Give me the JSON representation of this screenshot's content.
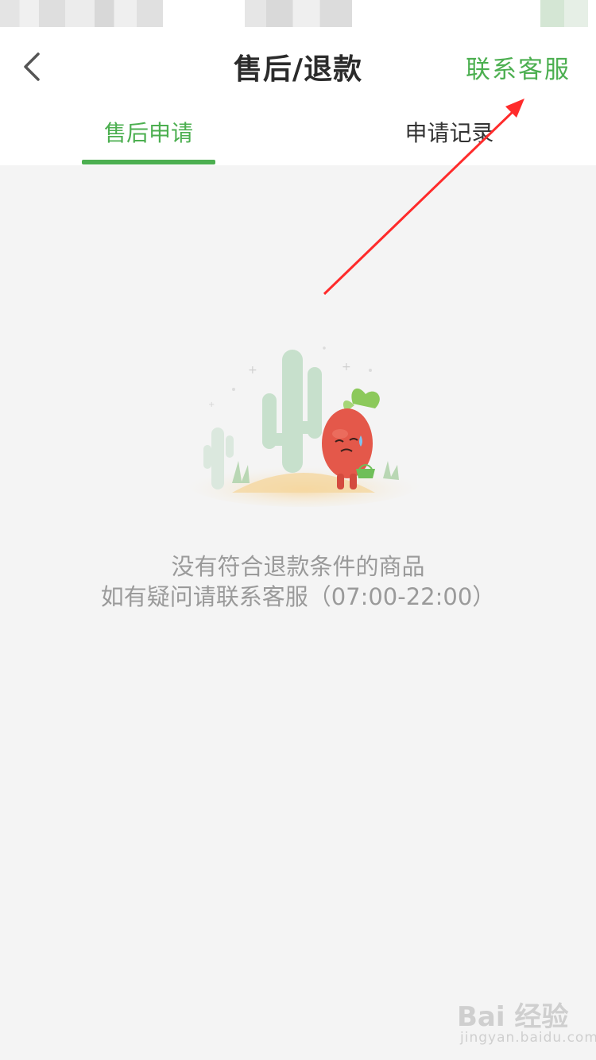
{
  "header": {
    "title": "售后/退款",
    "contact_label": "联系客服"
  },
  "tabs": [
    {
      "label": "售后申请",
      "active": true
    },
    {
      "label": "申请记录",
      "active": false
    }
  ],
  "empty_state": {
    "line1": "没有符合退款条件的商品",
    "line2": "如有疑问请联系客服（07:00-22:00）"
  },
  "watermark": {
    "brand": "Bai 经验",
    "url": "jingyan.baidu.com"
  },
  "icons": {
    "back": "chevron-left-icon",
    "illustration": "empty-cactus-radish-illustration"
  },
  "colors": {
    "accent": "#4caf50",
    "annotation_arrow": "#ff2b2b",
    "background": "#f4f4f4"
  }
}
